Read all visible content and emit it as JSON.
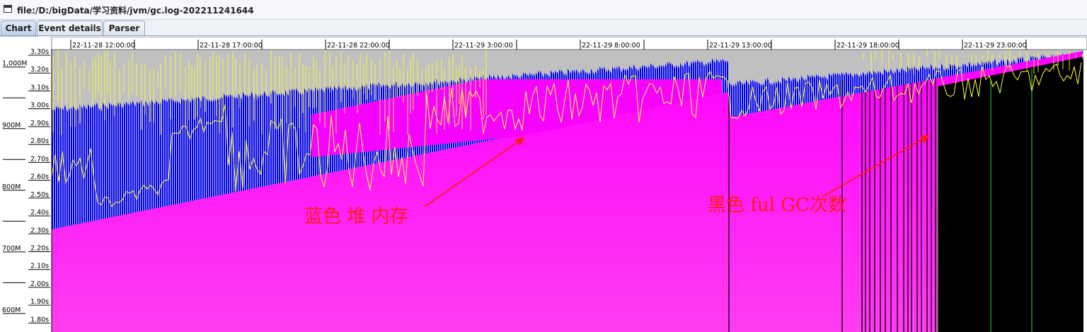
{
  "window": {
    "title": "file:/D:/bigData/学习资料/jvm/gc.log-202211241644"
  },
  "tabs": [
    {
      "label": "Chart",
      "active": true
    },
    {
      "label": "Event details",
      "active": false
    },
    {
      "label": "Parser",
      "active": false
    }
  ],
  "chart_data": {
    "type": "area",
    "x_ticks": [
      "22-11-28 12:00:00",
      "22-11-28 17:00:00",
      "22-11-28 22:00:00",
      "22-11-29 3:00:00",
      "22-11-29 8:00:00",
      "22-11-29 13:00:00",
      "22-11-29 18:00:00",
      "22-11-29 23:00:00"
    ],
    "memory_axis_ticks": [
      "1,000M",
      "900M",
      "800M",
      "700M",
      "600M"
    ],
    "memory_axis_range": [
      570,
      1010
    ],
    "pause_axis_ticks": [
      "3.30s",
      "3.20s",
      "3.10s",
      "3.00s",
      "2.90s",
      "2.80s",
      "2.70s",
      "2.60s",
      "2.50s",
      "2.40s",
      "2.30s",
      "2.20s",
      "2.10s",
      "2.00s",
      "1.90s",
      "1.80s"
    ],
    "series": [
      {
        "role": "used-heap",
        "color": "#ff00ff"
      },
      {
        "role": "total-heap",
        "color": "#0000ff"
      },
      {
        "role": "pause-time",
        "color": "#ffff33"
      },
      {
        "role": "full-gc",
        "color": "#000000"
      },
      {
        "role": "background",
        "color": "#c0c0c0"
      }
    ],
    "annotations": [
      {
        "text": "蓝色 堆 内存"
      },
      {
        "text": "黑色 ful GC次数"
      }
    ]
  }
}
